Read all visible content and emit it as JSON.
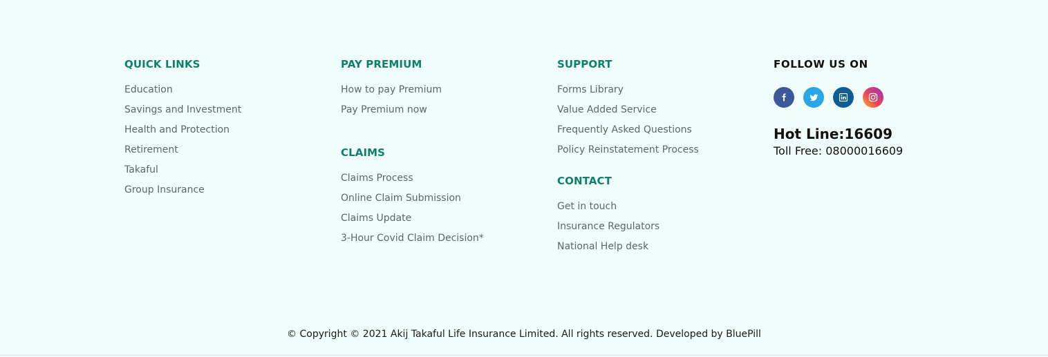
{
  "quick_links": {
    "heading": "QUICK LINKS",
    "items": [
      "Education",
      "Savings and Investment",
      "Health and Protection",
      "Retirement",
      "Takaful",
      "Group Insurance"
    ]
  },
  "pay_premium": {
    "heading": "PAY PREMIUM",
    "items": [
      "How to pay Premium",
      "Pay Premium now"
    ]
  },
  "claims": {
    "heading": "CLAIMS",
    "items": [
      "Claims Process",
      "Online Claim Submission",
      "Claims Update",
      "3-Hour Covid Claim Decision*"
    ]
  },
  "support": {
    "heading": "SUPPORT",
    "items": [
      "Forms Library",
      "Value Added Service",
      "Frequently Asked Questions",
      "Policy Reinstatement Process"
    ]
  },
  "contact": {
    "heading": "CONTACT",
    "items": [
      "Get in touch",
      "Insurance Regulators",
      "National Help desk"
    ]
  },
  "follow": {
    "heading": "FOLLOW US ON",
    "social": [
      {
        "icon": "facebook-icon",
        "color": "#3b5998"
      },
      {
        "icon": "twitter-icon",
        "color": "#2ba6e4"
      },
      {
        "icon": "linkedin-icon",
        "color": "#0e5d94"
      },
      {
        "icon": "instagram-icon",
        "color": "#e94356"
      }
    ],
    "hotline": "Hot Line:16609",
    "tollfree": "Toll Free: 08000016609"
  },
  "copyright": "© Copyright © 2021 Akij Takaful Life Insurance Limited. All rights reserved. Developed by BluePill",
  "colors": {
    "background": "#f0fcfa",
    "heading_accent": "#0f7f6b",
    "link_text": "#5e6665"
  }
}
